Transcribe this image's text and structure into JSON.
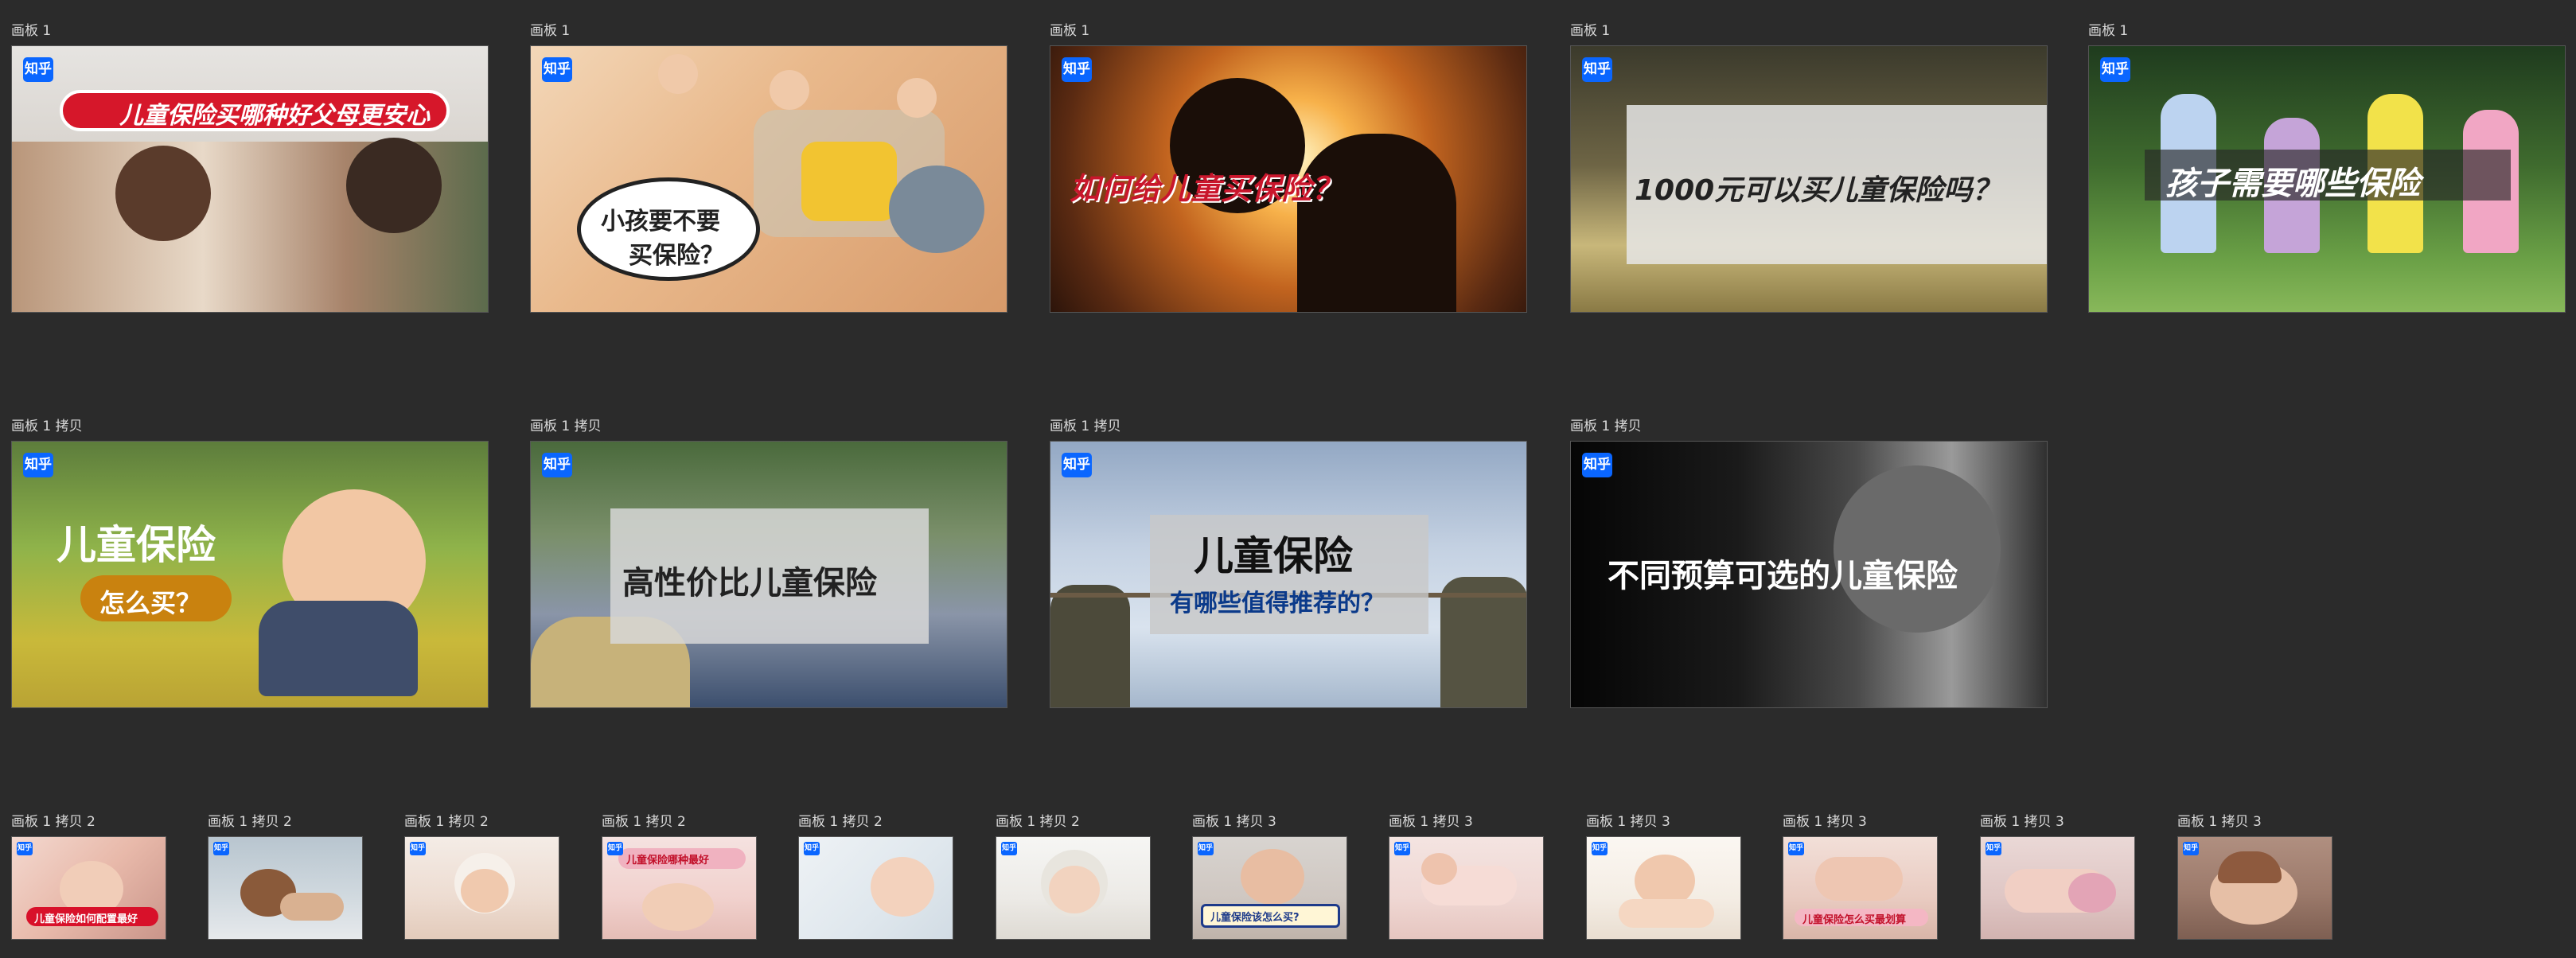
{
  "boards": [
    {
      "label": "画板 1",
      "badge": "知乎",
      "title": "儿童保险买哪种好父母更安心"
    },
    {
      "label": "画板 1",
      "badge": "知乎",
      "title_1": "小孩要不要",
      "title_2": "买保险？"
    },
    {
      "label": "画板 1",
      "badge": "知乎",
      "title": "如何给儿童买保险？"
    },
    {
      "label": "画板 1",
      "badge": "知乎",
      "title": "1000元可以买儿童保险吗？"
    },
    {
      "label": "画板 1",
      "badge": "知乎",
      "title": "孩子需要哪些保险"
    },
    {
      "label": "画板 1 拷贝",
      "badge": "知乎",
      "title_1": "儿童保险",
      "title_2": "怎么买？"
    },
    {
      "label": "画板 1 拷贝",
      "badge": "知乎",
      "title": "高性价比儿童保险"
    },
    {
      "label": "画板 1 拷贝",
      "badge": "知乎",
      "title_1": "儿童保险",
      "title_2": "有哪些值得推荐的？"
    },
    {
      "label": "画板 1 拷贝",
      "badge": "知乎",
      "title": "不同预算可选的儿童保险"
    }
  ],
  "small_boards": [
    {
      "label": "画板 1 拷贝 2",
      "badge": "知乎",
      "caption": "儿童保险如何配置最好"
    },
    {
      "label": "画板 1 拷贝 2",
      "badge": "知乎",
      "caption": ""
    },
    {
      "label": "画板 1 拷贝 2",
      "badge": "知乎",
      "caption": ""
    },
    {
      "label": "画板 1 拷贝 2",
      "badge": "知乎",
      "caption": "儿童保险哪种最好"
    },
    {
      "label": "画板 1 拷贝 2",
      "badge": "知乎",
      "caption": ""
    },
    {
      "label": "画板 1 拷贝 2",
      "badge": "知乎",
      "caption": ""
    },
    {
      "label": "画板 1 拷贝 3",
      "badge": "知乎",
      "caption": "儿童保险该怎么买?"
    },
    {
      "label": "画板 1 拷贝 3",
      "badge": "知乎",
      "caption": ""
    },
    {
      "label": "画板 1 拷贝 3",
      "badge": "知乎",
      "caption": ""
    },
    {
      "label": "画板 1 拷贝 3",
      "badge": "知乎",
      "caption": "儿童保险怎么买最划算"
    },
    {
      "label": "画板 1 拷贝 3",
      "badge": "知乎",
      "caption": ""
    },
    {
      "label": "画板 1 拷贝 3",
      "badge": "知乎",
      "caption": ""
    }
  ]
}
